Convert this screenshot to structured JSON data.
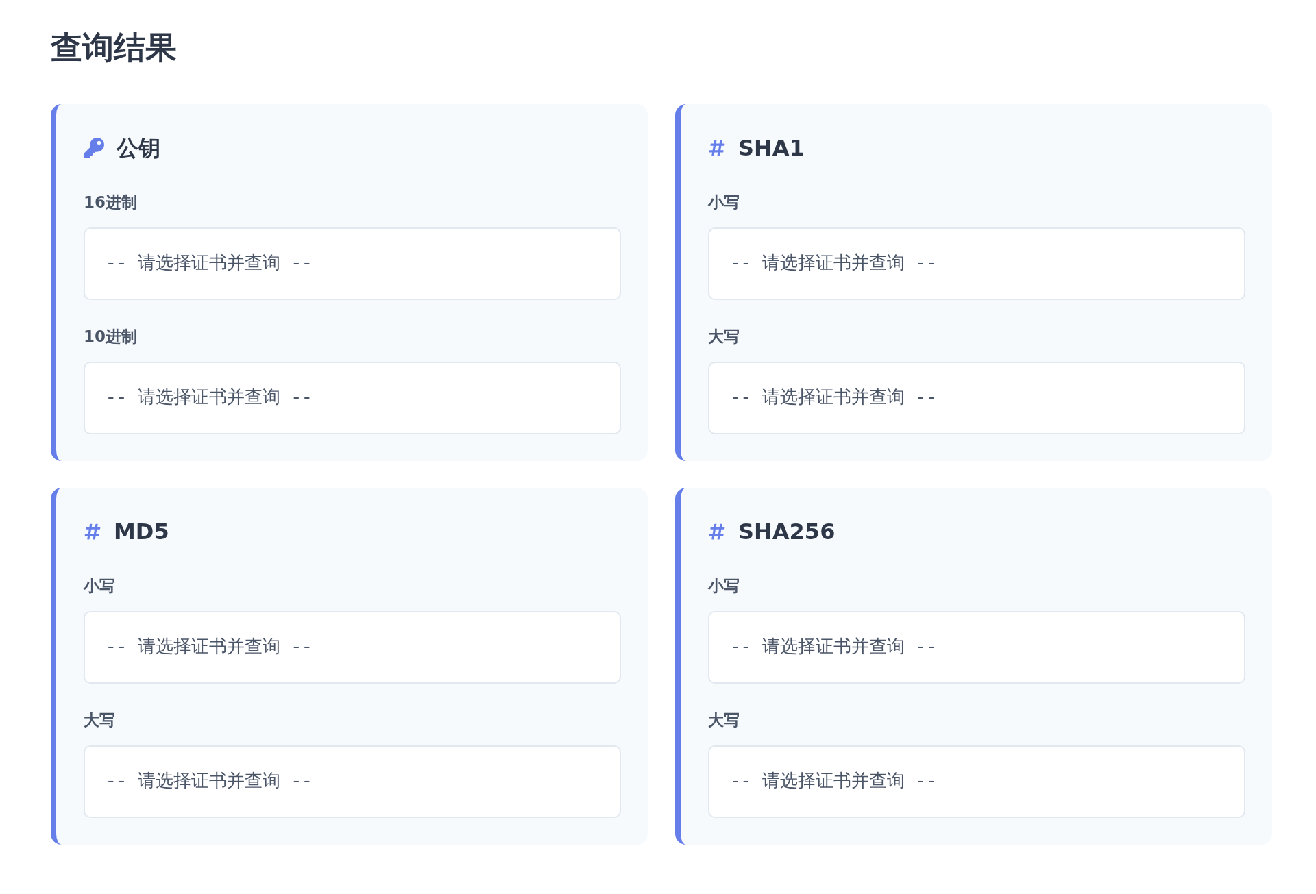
{
  "title": "查询结果",
  "cards": [
    {
      "kind": "key",
      "title": "公钥",
      "fields": [
        {
          "label": "16进制",
          "value": "-- 请选择证书并查询 --"
        },
        {
          "label": "10进制",
          "value": "-- 请选择证书并查询 --"
        }
      ]
    },
    {
      "kind": "hash",
      "title": "SHA1",
      "fields": [
        {
          "label": "小写",
          "value": "-- 请选择证书并查询 --"
        },
        {
          "label": "大写",
          "value": "-- 请选择证书并查询 --"
        }
      ]
    },
    {
      "kind": "hash",
      "title": "MD5",
      "fields": [
        {
          "label": "小写",
          "value": "-- 请选择证书并查询 --"
        },
        {
          "label": "大写",
          "value": "-- 请选择证书并查询 --"
        }
      ]
    },
    {
      "kind": "hash",
      "title": "SHA256",
      "fields": [
        {
          "label": "小写",
          "value": "-- 请选择证书并查询 --"
        },
        {
          "label": "大写",
          "value": "-- 请选择证书并查询 --"
        }
      ]
    }
  ]
}
